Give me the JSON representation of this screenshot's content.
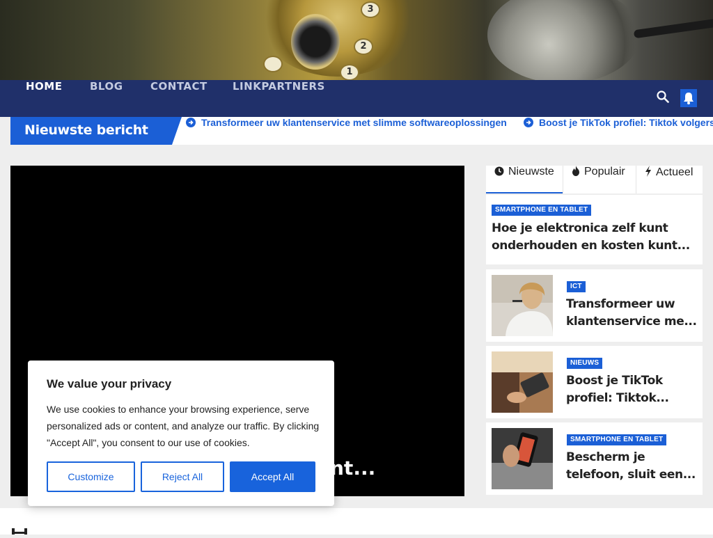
{
  "nav": {
    "items": [
      "HOME",
      "BLOG",
      "CONTACT",
      "LINKPARTNERS"
    ]
  },
  "ticker": {
    "label": "Nieuwste bericht",
    "fragment": "n",
    "items": [
      "Transformeer uw klantenservice met slimme softwareoplossingen",
      "Boost je TikTok profiel: Tiktok volgers"
    ]
  },
  "main": {
    "title_fragment": "nt..."
  },
  "sidebar": {
    "tabs": [
      "Nieuwste",
      "Populair",
      "Actueel"
    ],
    "posts": [
      {
        "category": "SMARTPHONE EN TABLET",
        "title_line1": "Hoe je elektronica zelf kunt",
        "title_line2": "onderhouden en kosten kunt..."
      },
      {
        "category": "ICT",
        "title_line1": "Transformeer uw",
        "title_line2": "klantenservice me..."
      },
      {
        "category": "NIEUWS",
        "title_line1": "Boost je TikTok",
        "title_line2": "profiel: Tiktok..."
      },
      {
        "category": "SMARTPHONE EN TABLET",
        "title_line1": "Bescherm je",
        "title_line2": "telefoon, sluit een..."
      }
    ]
  },
  "cookie": {
    "title": "We value your privacy",
    "text": "We use cookies to enhance your browsing experience, serve personalized ads or content, and analyze our traffic. By clicking \"Accept All\", you consent to our use of cookies.",
    "customize": "Customize",
    "reject": "Reject All",
    "accept": "Accept All"
  },
  "colors": {
    "nav_bg": "#20306a",
    "accent": "#1b5fd6",
    "cookie_accent": "#1863dc"
  },
  "icons": [
    "search-icon",
    "bell-icon",
    "arrow-circle-icon",
    "clock-icon",
    "fire-icon",
    "bolt-icon"
  ]
}
